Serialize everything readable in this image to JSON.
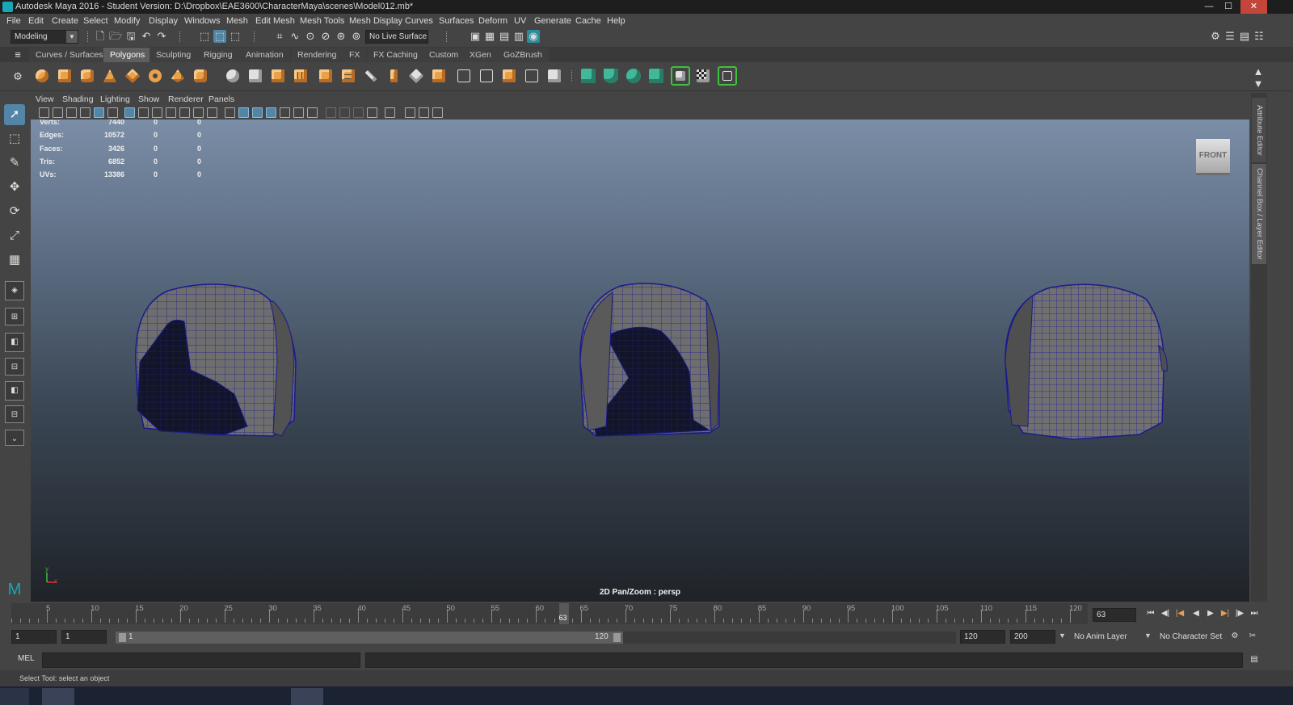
{
  "window": {
    "title": "Autodesk Maya 2016 - Student Version: D:\\Dropbox\\EAE3600\\CharacterMaya\\scenes\\Model012.mb*",
    "minimize": "—",
    "maximize": "☐",
    "close": "✕"
  },
  "menu": [
    "File",
    "Edit",
    "Create",
    "Select",
    "Modify",
    "Display",
    "Windows",
    "Mesh",
    "Edit Mesh",
    "Mesh Tools",
    "Mesh Display",
    "Curves",
    "Surfaces",
    "Deform",
    "UV",
    "Generate",
    "Cache",
    "Help"
  ],
  "statusline": {
    "mode": "Modeling",
    "live_surface": "No Live Surface"
  },
  "shelf": {
    "tabs": [
      "Curves / Surfaces",
      "Polygons",
      "Sculpting",
      "Rigging",
      "Animation",
      "Rendering",
      "FX",
      "FX Caching",
      "Custom",
      "XGen",
      "GoZBrush"
    ],
    "active_tab": "Polygons"
  },
  "panel_menu": [
    "View",
    "Shading",
    "Lighting",
    "Show",
    "Renderer",
    "Panels"
  ],
  "hud": {
    "rows": [
      {
        "label": "Verts:",
        "value": "7440",
        "c2": "0",
        "c3": "0"
      },
      {
        "label": "Edges:",
        "value": "10572",
        "c2": "0",
        "c3": "0"
      },
      {
        "label": "Faces:",
        "value": "3426",
        "c2": "0",
        "c3": "0"
      },
      {
        "label": "Tris:",
        "value": "6852",
        "c2": "0",
        "c3": "0"
      },
      {
        "label": "UVs:",
        "value": "13386",
        "c2": "0",
        "c3": "0"
      }
    ]
  },
  "viewport": {
    "viewcube_label": "FRONT",
    "camera_label": "2D Pan/Zoom : persp",
    "axis_y": "y",
    "axis_x": "x"
  },
  "right_tabs": {
    "attribute_editor": "Attribute Editor",
    "channel_box": "Channel Box / Layer Editor"
  },
  "time_slider": {
    "tick_labels": [
      "5",
      "10",
      "15",
      "20",
      "25",
      "30",
      "35",
      "40",
      "45",
      "50",
      "55",
      "60",
      "65",
      "70",
      "75",
      "80",
      "85",
      "90",
      "95",
      "100",
      "105",
      "110",
      "115",
      "120"
    ],
    "current_frame": "63",
    "current_frame_field": "63"
  },
  "range_slider": {
    "start_time": "1",
    "playback_start": "1",
    "range_start_label": "1",
    "range_end_label": "120",
    "playback_end": "120",
    "end_time": "200",
    "anim_layer": "No Anim Layer",
    "character_set": "No Character Set"
  },
  "command_line": {
    "label": "MEL"
  },
  "help_line": "Select Tool: select an object",
  "colors": {
    "accent": "#5285a6",
    "shelf_icon_orange": "#e9a24a",
    "wire": "#1a1a8c",
    "mesh": "#6f6f6f"
  }
}
